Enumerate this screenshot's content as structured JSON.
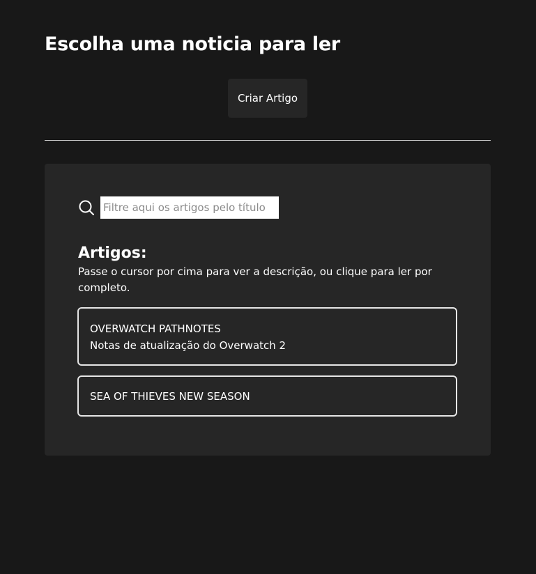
{
  "header": {
    "title": "Escolha uma noticia para ler",
    "create_button_label": "Criar Artigo"
  },
  "search": {
    "placeholder": "Filtre aqui os artigos pelo título",
    "value": "",
    "icon": "search-icon"
  },
  "articles": {
    "heading": "Artigos:",
    "hint": "Passe o cursor por cima para ver a descrição, ou clique para ler por completo.",
    "items": [
      {
        "title": "OVERWATCH PATHNOTES",
        "description": "Notas de atualização do Overwatch 2"
      },
      {
        "title": "SEA OF THIEVES NEW SEASON",
        "description": ""
      }
    ]
  },
  "colors": {
    "background": "#181818",
    "panel": "#262626",
    "text": "#ffffff",
    "card_border": "#e6e6e6",
    "divider": "#cfcfcf"
  }
}
